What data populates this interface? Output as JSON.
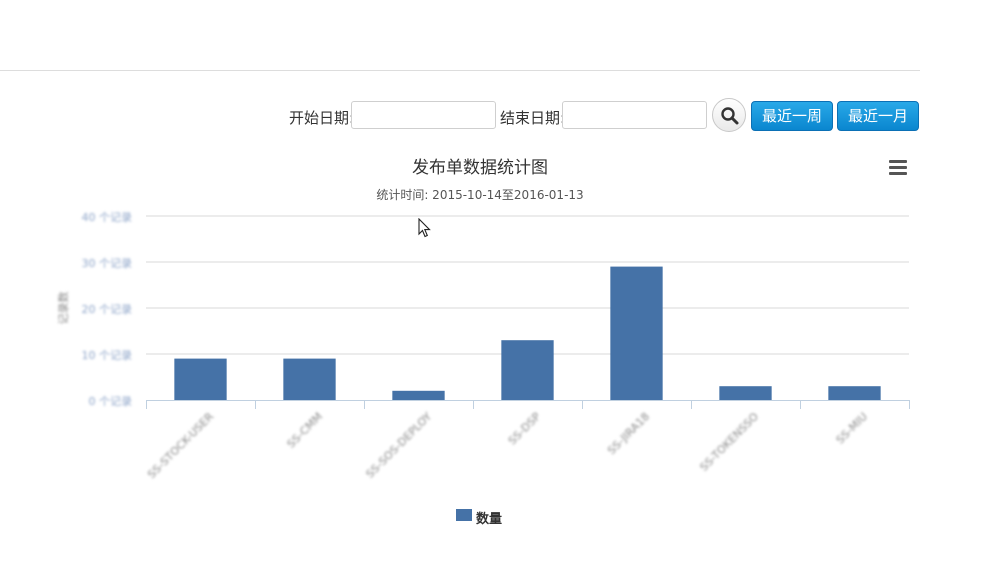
{
  "filters": {
    "start_label": "开始日期:",
    "start_value": "",
    "end_label": "结束日期:",
    "end_value": "",
    "search_icon": "search-icon",
    "last_week_label": "最近一周",
    "last_month_label": "最近一月",
    "button_color": "#0a86cf"
  },
  "chart_menu_icon": "menu-icon",
  "chart_data": {
    "type": "bar",
    "title": "发布单数据统计图",
    "subtitle": "统计时间: 2015-10-14至2016-01-13",
    "ylabel": "记录数",
    "ytick_labels": [
      "0 个记录",
      "10 个记录",
      "20 个记录",
      "30 个记录",
      "40 个记录"
    ],
    "ylim": [
      0,
      40
    ],
    "categories": [
      "SS-STOCK-USER",
      "SS-CMM",
      "SS-SOS-DEPLOY",
      "SS-DSP",
      "SS-JIRA18",
      "SS-TOKENSSO",
      "SS-MIU"
    ],
    "series": [
      {
        "name": "数量",
        "color": "#4572a7",
        "values": [
          9,
          9,
          2,
          13,
          29,
          3,
          3
        ]
      }
    ],
    "grid": true,
    "legend": "bottom-center"
  }
}
